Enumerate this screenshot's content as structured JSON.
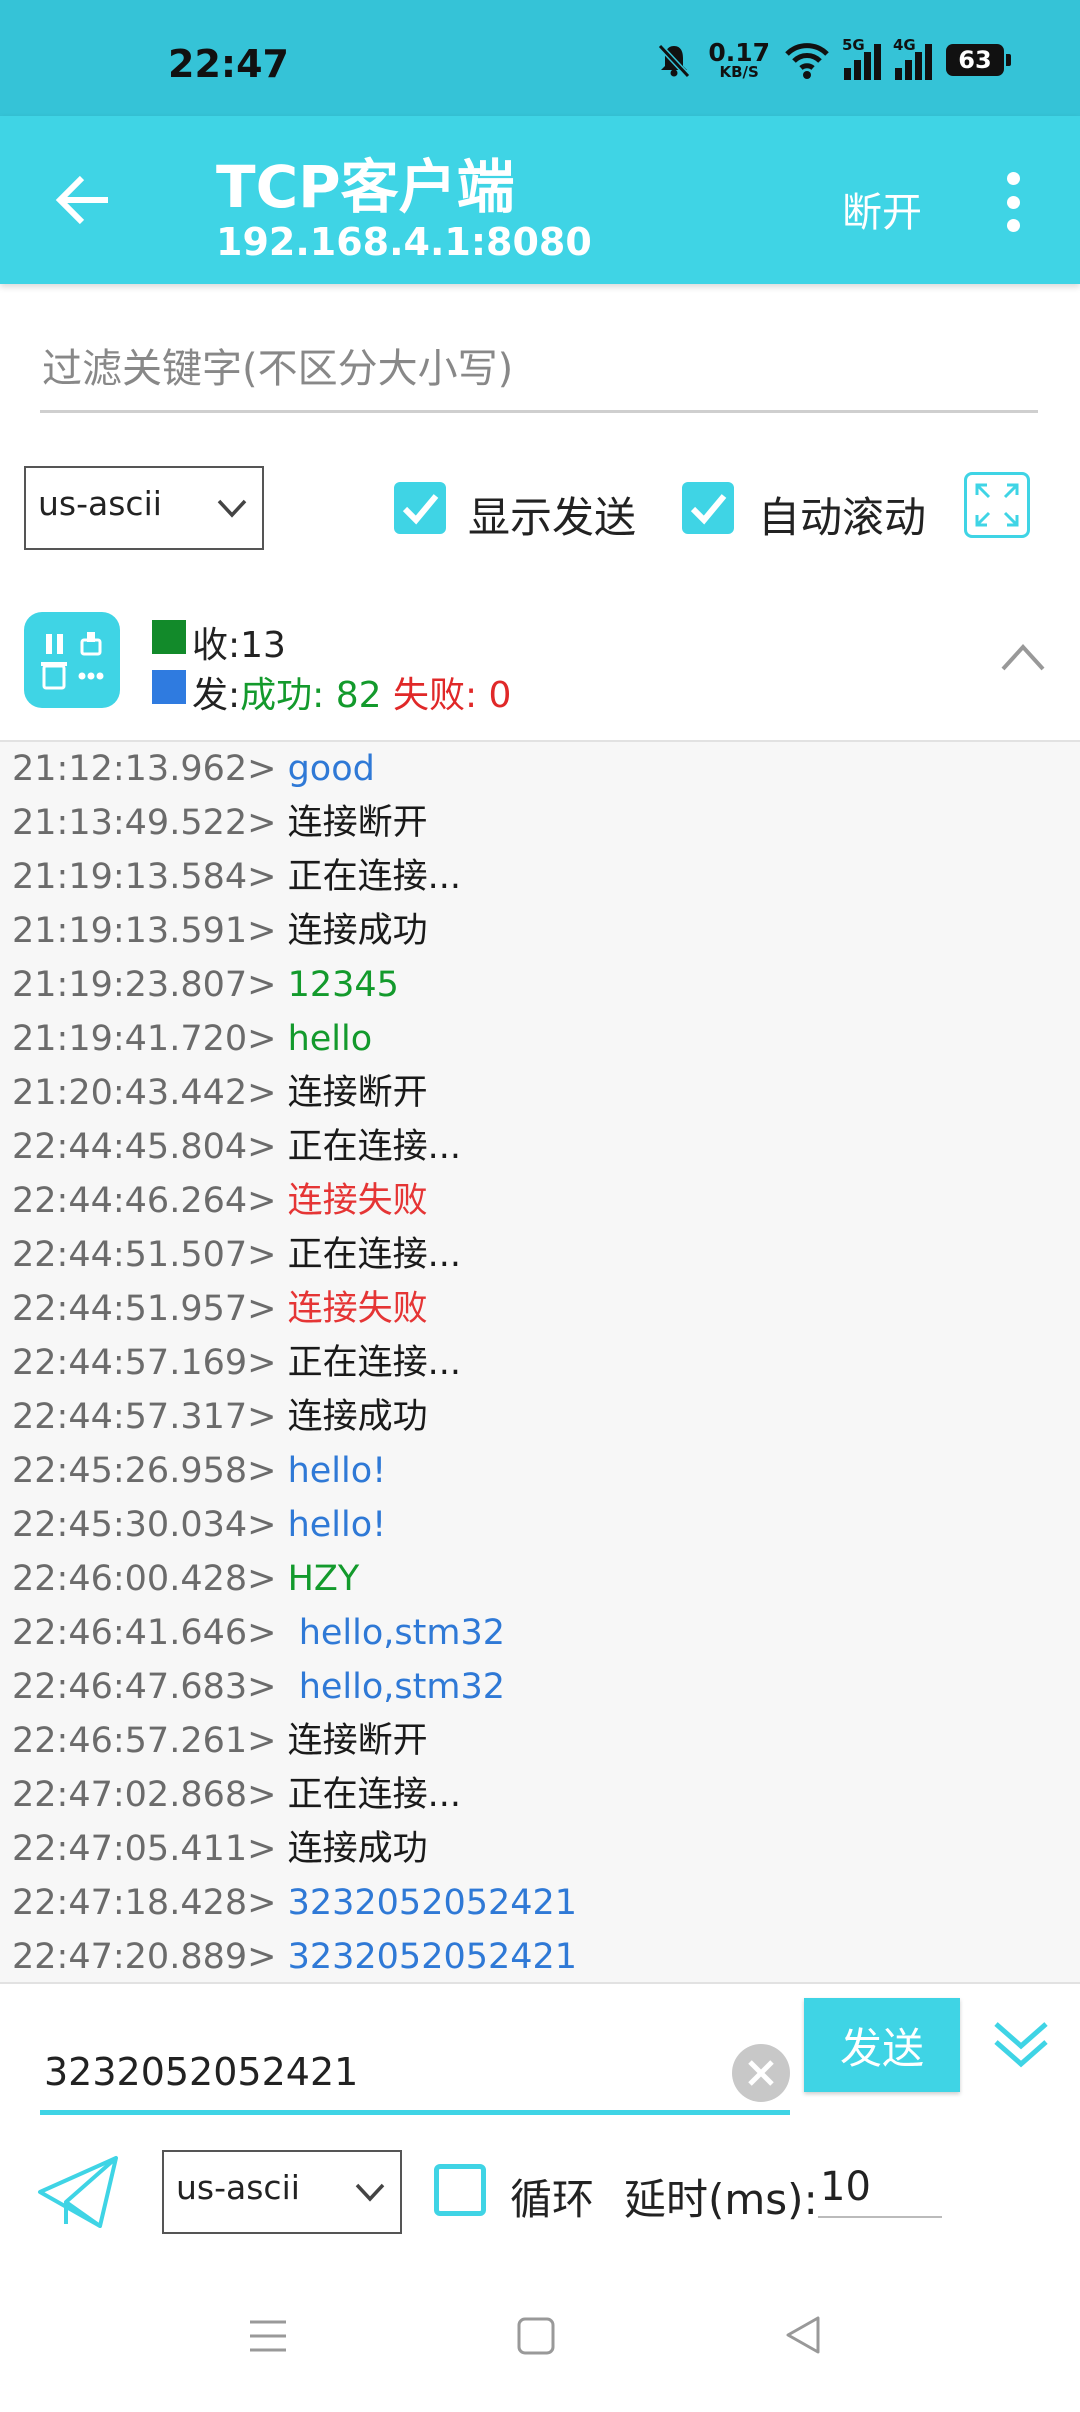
{
  "status_bar": {
    "time": "22:47",
    "net_speed_value": "0.17",
    "net_speed_unit": "KB/S",
    "signal1_label": "5G",
    "signal2_label": "4G",
    "battery": "63"
  },
  "app_bar": {
    "title": "TCP客户端",
    "subtitle": "192.168.4.1:8080",
    "disconnect_label": "断开"
  },
  "filter": {
    "placeholder": "过滤关键字(不区分大小写)"
  },
  "options": {
    "encoding": "us-ascii",
    "show_send_label": "显示发送",
    "show_send_checked": true,
    "auto_scroll_label": "自动滚动",
    "auto_scroll_checked": true
  },
  "stats": {
    "recv_label": "收:",
    "recv_count": "13",
    "send_label": "发:",
    "success_label": "成功: 82",
    "fail_label": "失败: 0",
    "recv_color": "#128a2a",
    "send_color": "#2f7be0"
  },
  "log": [
    {
      "time": "21:12:13.962>",
      "msg": "good",
      "kind": "sent"
    },
    {
      "time": "21:13:49.522>",
      "msg": "连接断开",
      "kind": "sys"
    },
    {
      "time": "21:19:13.584>",
      "msg": "正在连接...",
      "kind": "sys"
    },
    {
      "time": "21:19:13.591>",
      "msg": "连接成功",
      "kind": "sys"
    },
    {
      "time": "21:19:23.807>",
      "msg": "12345",
      "kind": "recv"
    },
    {
      "time": "21:19:41.720>",
      "msg": "hello",
      "kind": "recv"
    },
    {
      "time": "21:20:43.442>",
      "msg": "连接断开",
      "kind": "sys"
    },
    {
      "time": "22:44:45.804>",
      "msg": "正在连接...",
      "kind": "sys"
    },
    {
      "time": "22:44:46.264>",
      "msg": "连接失败",
      "kind": "err"
    },
    {
      "time": "22:44:51.507>",
      "msg": "正在连接...",
      "kind": "sys"
    },
    {
      "time": "22:44:51.957>",
      "msg": "连接失败",
      "kind": "err"
    },
    {
      "time": "22:44:57.169>",
      "msg": "正在连接...",
      "kind": "sys"
    },
    {
      "time": "22:44:57.317>",
      "msg": "连接成功",
      "kind": "sys"
    },
    {
      "time": "22:45:26.958>",
      "msg": "hello!",
      "kind": "sent"
    },
    {
      "time": "22:45:30.034>",
      "msg": "hello!",
      "kind": "sent"
    },
    {
      "time": "22:46:00.428>",
      "msg": "HZY",
      "kind": "recv"
    },
    {
      "time": "22:46:41.646>",
      "msg": " hello,stm32",
      "kind": "sent"
    },
    {
      "time": "22:46:47.683>",
      "msg": " hello,stm32",
      "kind": "sent"
    },
    {
      "time": "22:46:57.261>",
      "msg": "连接断开",
      "kind": "sys"
    },
    {
      "time": "22:47:02.868>",
      "msg": "正在连接...",
      "kind": "sys"
    },
    {
      "time": "22:47:05.411>",
      "msg": "连接成功",
      "kind": "sys"
    },
    {
      "time": "22:47:18.428>",
      "msg": "3232052052421",
      "kind": "sent"
    },
    {
      "time": "22:47:20.889>",
      "msg": "3232052052421",
      "kind": "sent"
    }
  ],
  "input": {
    "message": "3232052052421",
    "send_label": "发送",
    "encoding": "us-ascii",
    "loop_label": "循环",
    "loop_checked": false,
    "delay_label": "延时(ms):",
    "delay_value": "10"
  }
}
